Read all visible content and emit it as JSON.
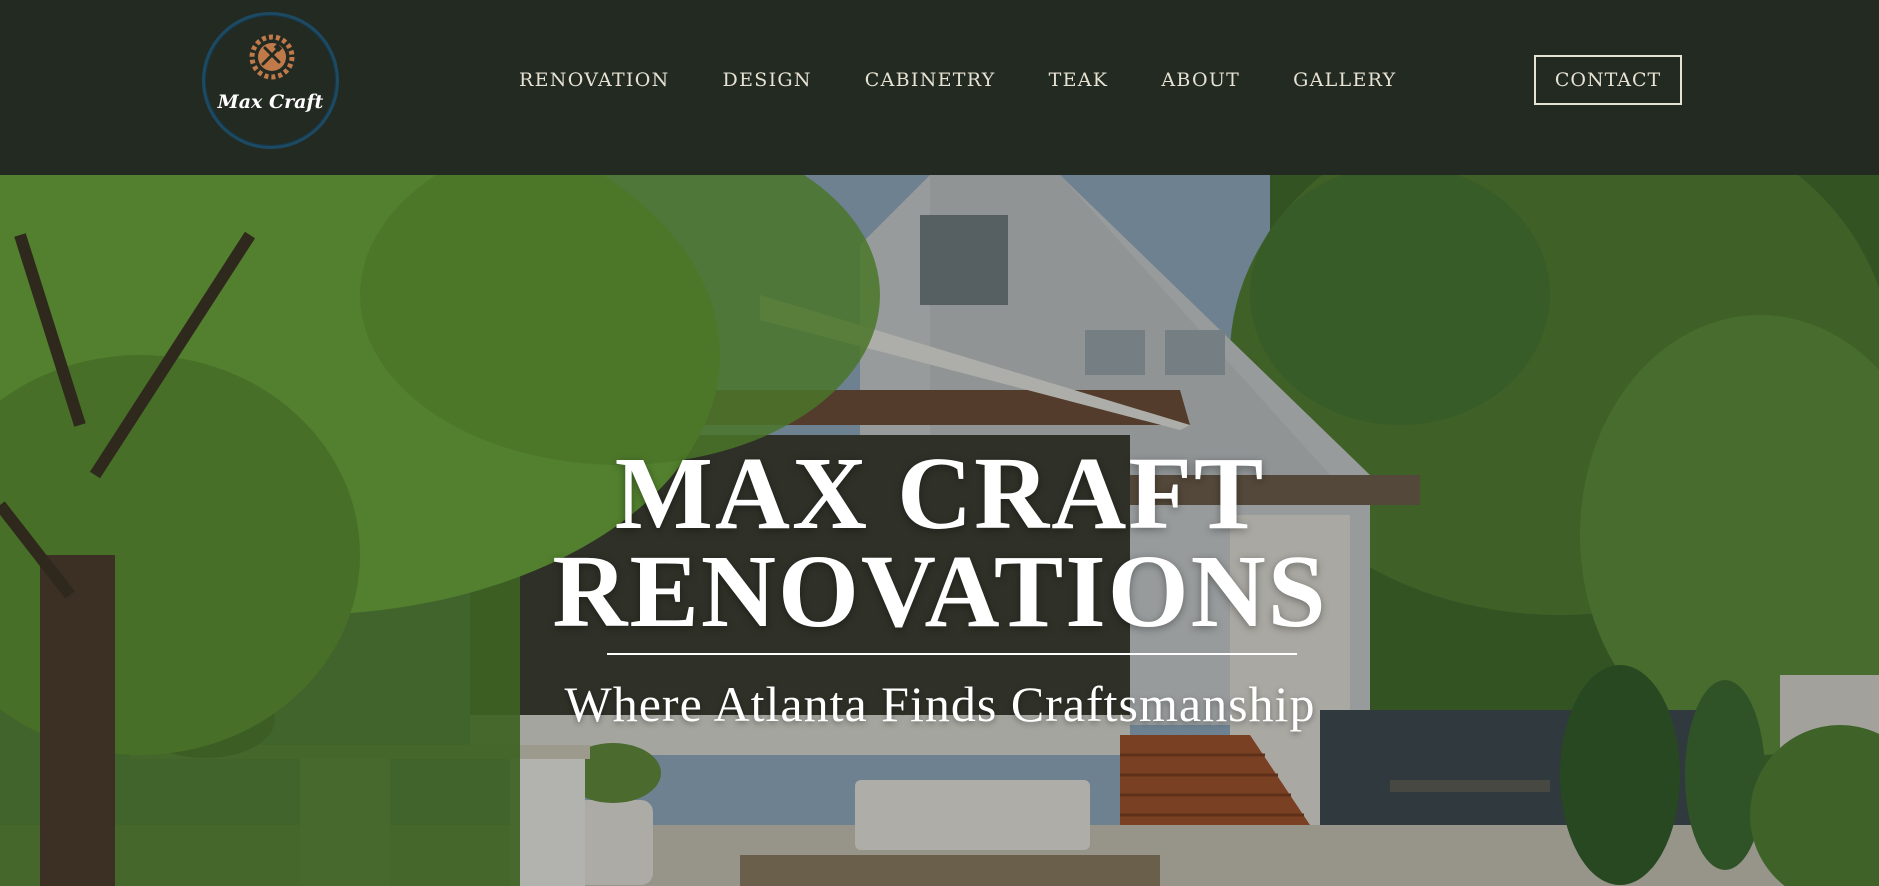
{
  "header": {
    "logo_text": "Max Craft",
    "nav": [
      {
        "label": "RENOVATION"
      },
      {
        "label": "DESIGN"
      },
      {
        "label": "CABINETRY"
      },
      {
        "label": "TEAK"
      },
      {
        "label": "ABOUT"
      },
      {
        "label": "GALLERY"
      }
    ],
    "contact_label": "CONTACT"
  },
  "hero": {
    "title_line1": "MAX CRAFT",
    "title_line2": "RENOVATIONS",
    "subtitle": "Where Atlanta Finds Craftsmanship",
    "background_image": "house-backyard-photo"
  },
  "colors": {
    "header_bg": "#232a21",
    "nav_text": "#e6e2d4",
    "logo_ring": "#1d4a63",
    "logo_emblem": "#c07a4a",
    "hero_text": "#ffffff"
  }
}
